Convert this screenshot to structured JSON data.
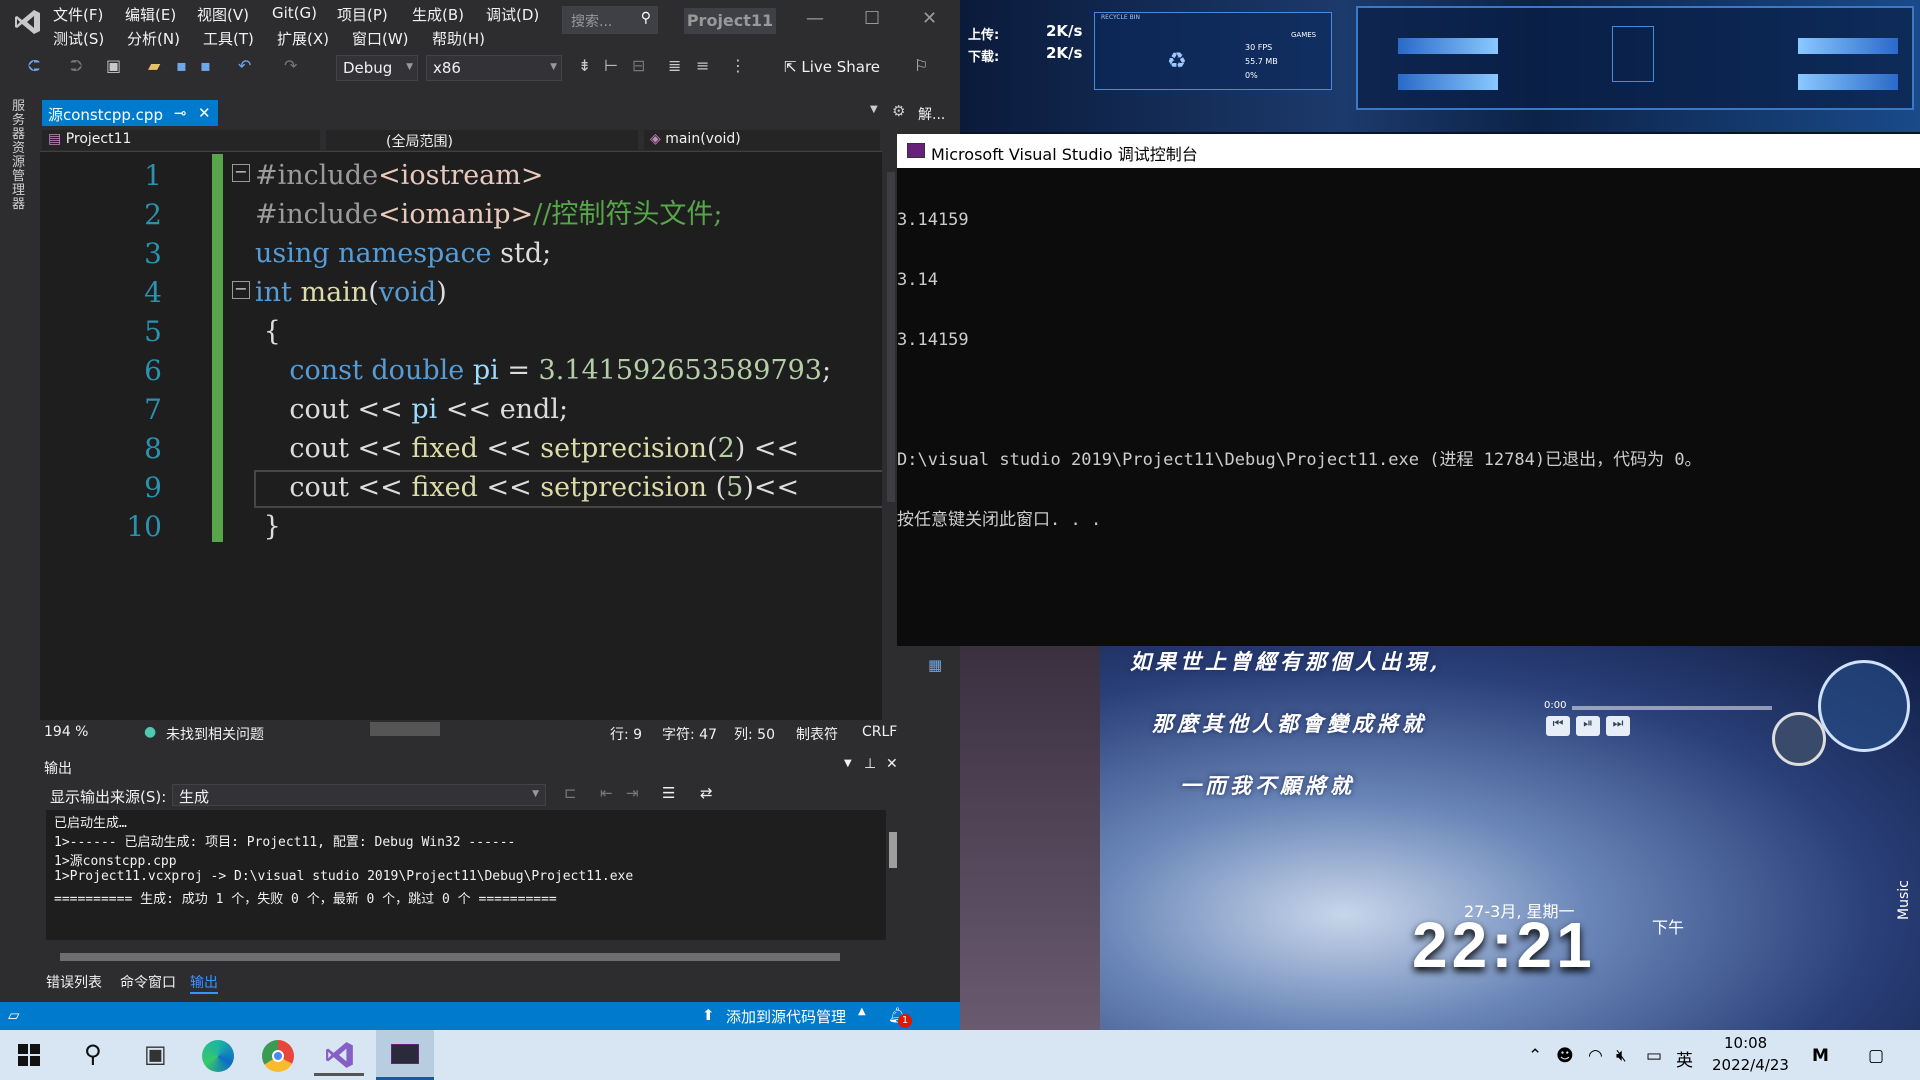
{
  "menu": {
    "row1": [
      "文件(F)",
      "编辑(E)",
      "视图(V)",
      "Git(G)",
      "项目(P)",
      "生成(B)",
      "调试(D)"
    ],
    "row2": [
      "测试(S)",
      "分析(N)",
      "工具(T)",
      "扩展(X)",
      "窗口(W)",
      "帮助(H)"
    ],
    "search_placeholder": "搜索...",
    "project": "Project11"
  },
  "toolbar": {
    "config": "Debug",
    "platform": "x86",
    "live_share": "Live Share"
  },
  "side_label": "服务器资源管理器",
  "tab": {
    "name": "源constcpp.cpp",
    "pin": "⊸",
    "close": "✕"
  },
  "tab_right": "解...",
  "nav": {
    "project": "Project11",
    "scope": "(全局范围)",
    "member": "main(void)"
  },
  "code_lines": [
    {
      "n": "1",
      "text": "#include<iostream>"
    },
    {
      "n": "2",
      "text": "#include<iomanip>//控制符头文件;"
    },
    {
      "n": "3",
      "text": "using namespace std;"
    },
    {
      "n": "4",
      "text": "int main(void)"
    },
    {
      "n": "5",
      "text": " {"
    },
    {
      "n": "6",
      "text": "    const double pi = 3.141592653589793;"
    },
    {
      "n": "7",
      "text": "    cout << pi << endl;"
    },
    {
      "n": "8",
      "text": "    cout << fixed << setprecision(2) <<"
    },
    {
      "n": "9",
      "text": "    cout << fixed << setprecision (5)<<"
    },
    {
      "n": "10",
      "text": " }"
    }
  ],
  "status": {
    "zoom": "194 %",
    "issues": "未找到相关问题",
    "line": "行: 9",
    "char": "字符: 47",
    "col": "列: 50",
    "tabs": "制表符",
    "eol": "CRLF"
  },
  "output": {
    "title": "输出",
    "source_label": "显示输出来源(S):",
    "source_value": "生成",
    "lines": [
      "已启动生成…",
      "1>------ 已启动生成: 项目: Project11, 配置: Debug Win32 ------",
      "1>源constcpp.cpp",
      "1>Project11.vcxproj -> D:\\visual studio 2019\\Project11\\Debug\\Project11.exe",
      "========== 生成: 成功 1 个，失败 0 个，最新 0 个，跳过 0 个 =========="
    ]
  },
  "bottom_tabs": [
    "错误列表",
    "命令窗口",
    "输出"
  ],
  "vs_status": {
    "scm": "添加到源代码管理",
    "notif_count": "1"
  },
  "console": {
    "title": "Microsoft Visual Studio 调试控制台",
    "lines": [
      "3.14159",
      "3.14",
      "3.14159",
      "",
      "D:\\visual studio 2019\\Project11\\Debug\\Project11.exe (进程 12784)已退出，代码为 0。",
      "按任意键关闭此窗口. . ."
    ]
  },
  "net": {
    "up_label": "上传:",
    "up": "2K/s",
    "down_label": "下载:",
    "down": "2K/s"
  },
  "widget": {
    "recycle": "RECYCLE BIN",
    "fps": "30 FPS",
    "mb": "55.7 MB",
    "pct": "0%",
    "games": "GAMES"
  },
  "lyrics": [
    "如果世上曾經有那個人出現,",
    "那麼其他人都會變成將就",
    "一而我不願將就"
  ],
  "music": {
    "time": "0:00",
    "label": "Music"
  },
  "desk_clock": {
    "date": "27-3月, 星期一",
    "time": "22:21",
    "ampm": "下午"
  },
  "taskbar": {
    "ime": "英",
    "time": "10:08",
    "date": "2022/4/23"
  }
}
